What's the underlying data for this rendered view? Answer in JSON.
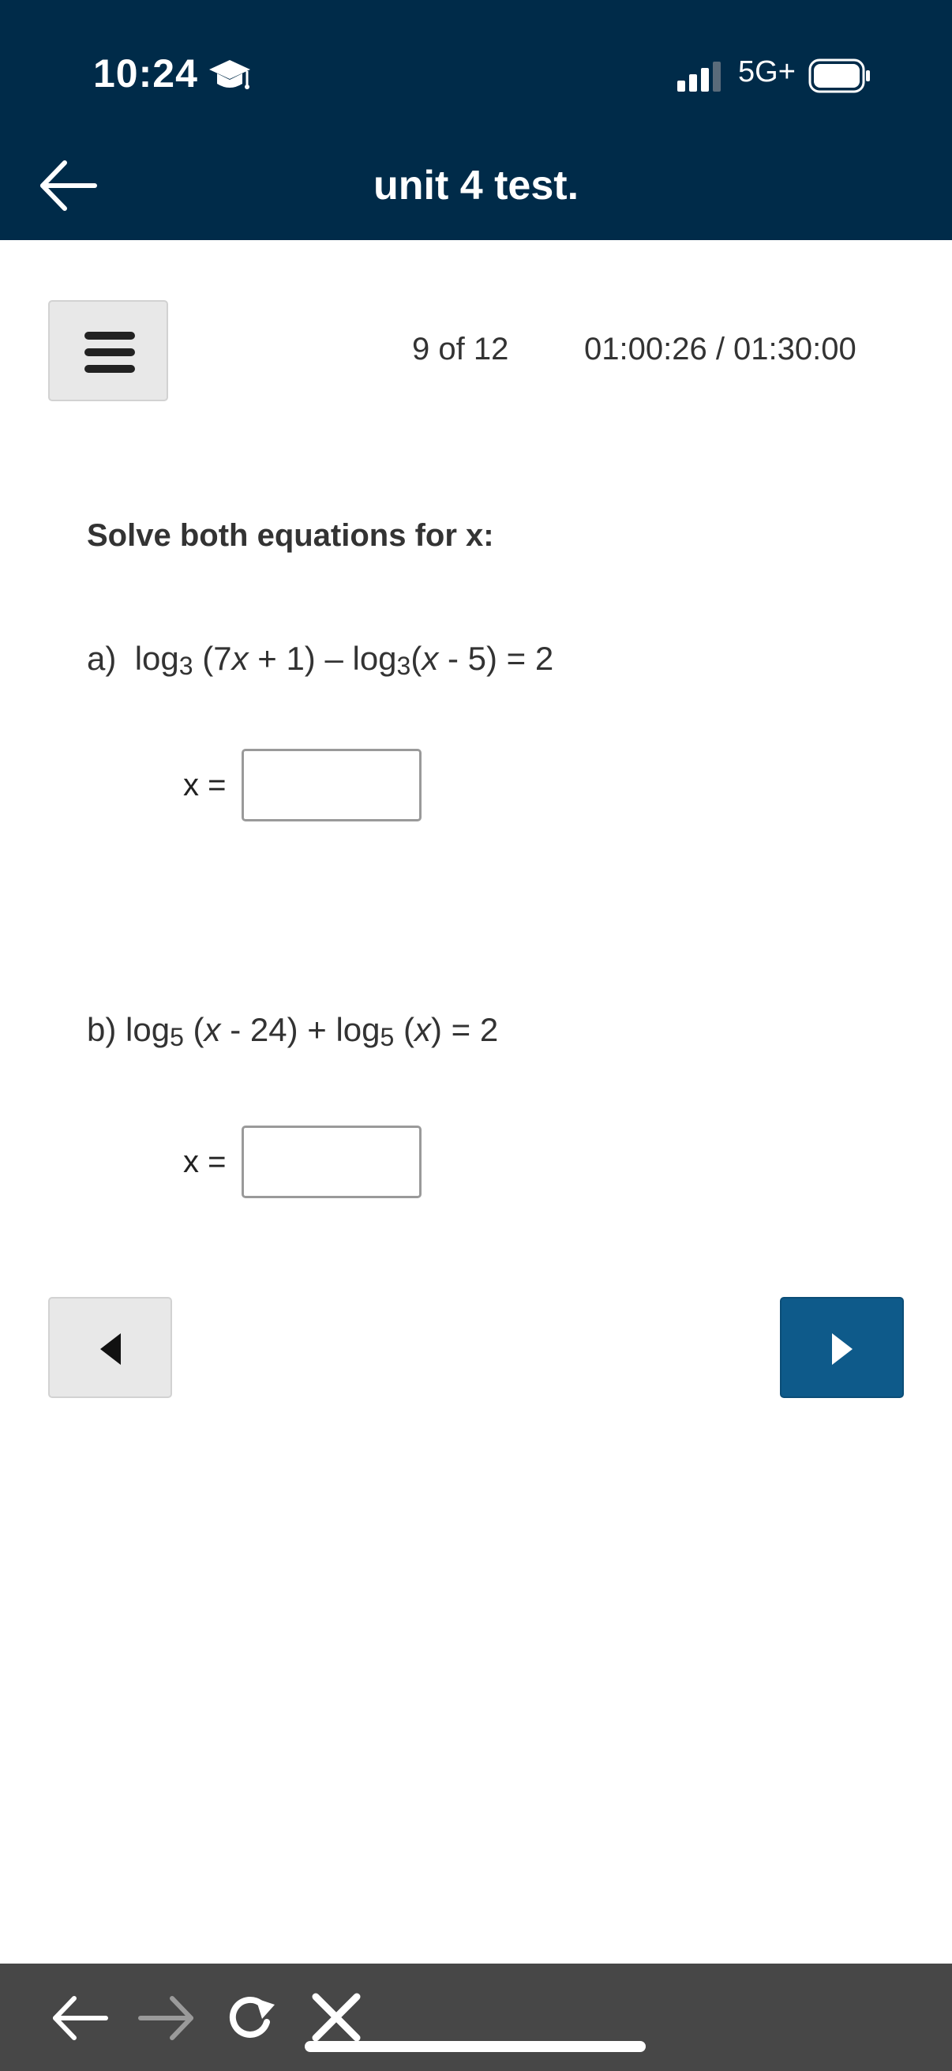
{
  "status_bar": {
    "time": "10:24",
    "network": "5G+",
    "icons": [
      "graduation-cap-icon",
      "signal-icon",
      "battery-icon"
    ]
  },
  "header": {
    "title": "unit 4 test.",
    "back_icon": "back-arrow-icon",
    "background": "#002b49"
  },
  "toolbar": {
    "menu_icon": "hamburger-menu-icon",
    "question_counter": "9 of 12",
    "timer": "01:00:26 / 01:30:00"
  },
  "question": {
    "prompt": "Solve both equations for x:",
    "part_a": {
      "label": "a)",
      "log": "log",
      "base1": "3",
      "arg1_open": " (7",
      "arg1_var": "x",
      "arg1_rest": " + 1) – ",
      "base2": "3",
      "arg2_open": "(",
      "arg2_var": "x",
      "arg2_rest": " - 5) = 2",
      "answer_label": "x =",
      "answer_value": ""
    },
    "part_b": {
      "label": "b)",
      "log": "log",
      "base1": "5",
      "arg1_open": " (",
      "arg1_var": "x",
      "arg1_rest": " - 24) + ",
      "base2": "5",
      "arg2_open": " (",
      "arg2_var": "x",
      "arg2_rest": ") = 2",
      "answer_label": "x =",
      "answer_value": ""
    }
  },
  "navigation": {
    "prev_icon": "caret-left-icon",
    "next_icon": "caret-right-icon",
    "next_color": "#0e5a8a"
  },
  "browser_bar": {
    "icons": [
      "back-icon",
      "forward-icon",
      "reload-icon",
      "close-icon"
    ]
  }
}
